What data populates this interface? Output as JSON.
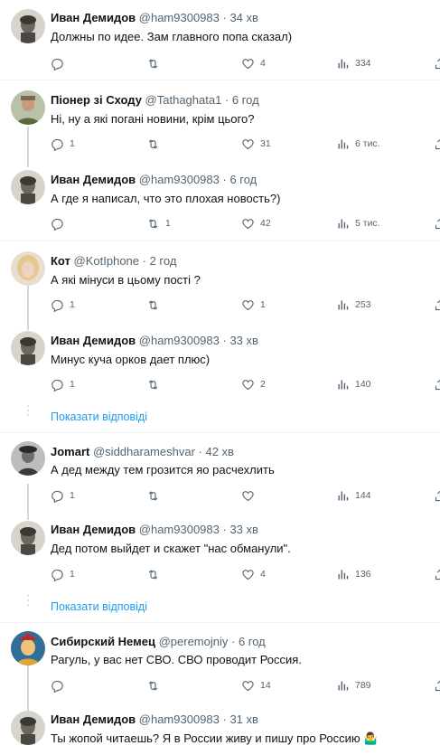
{
  "tweets": [
    {
      "name": "Иван Демидов",
      "handle": "@ham9300983",
      "time": "34 хв",
      "text": "Должны по идее. Зам главного попа сказал)",
      "reply": "",
      "retweet": "",
      "like": "4",
      "views": "334",
      "avatar": "statue"
    },
    {
      "name": "Піонер зі Сходу",
      "handle": "@Tathaghata1",
      "time": "6 год",
      "text": "Ні, ну а які погані новини, крім цього?",
      "reply": "1",
      "retweet": "",
      "like": "31",
      "views": "6 тис.",
      "avatar": "man"
    },
    {
      "name": "Иван Демидов",
      "handle": "@ham9300983",
      "time": "6 год",
      "text": "А где я написал, что это плохая новость?)",
      "reply": "",
      "retweet": "1",
      "like": "42",
      "views": "5 тис.",
      "avatar": "statue"
    },
    {
      "name": "Кот",
      "handle": "@KotIphone",
      "time": "2 год",
      "text": "А які мінуси в цьому пості ?",
      "reply": "1",
      "retweet": "",
      "like": "1",
      "views": "253",
      "avatar": "woman"
    },
    {
      "name": "Иван Демидов",
      "handle": "@ham9300983",
      "time": "33 хв",
      "text": "Минус куча орков дает плюс)",
      "reply": "1",
      "retweet": "",
      "like": "2",
      "views": "140",
      "avatar": "statue"
    },
    {
      "name": "Jomart",
      "handle": "@siddharameshvar",
      "time": "42 хв",
      "text": "А дед между тем грозится яо расчехлить",
      "reply": "1",
      "retweet": "",
      "like": "",
      "views": "144",
      "avatar": "bw"
    },
    {
      "name": "Иван Демидов",
      "handle": "@ham9300983",
      "time": "33 хв",
      "text": "Дед потом выйдет и скажет \"нас обманули\".",
      "reply": "1",
      "retweet": "",
      "like": "4",
      "views": "136",
      "avatar": "statue"
    },
    {
      "name": "Сибирский Немец",
      "handle": "@peremojniy",
      "time": "6 год",
      "text": "Рагуль, у вас нет СВО. СВО проводит Россия.",
      "reply": "",
      "retweet": "",
      "like": "14",
      "views": "789",
      "avatar": "colorful"
    },
    {
      "name": "Иван Демидов",
      "handle": "@ham9300983",
      "time": "31 хв",
      "text": "Ты жопой читаешь? Я в России живу и пишу про Россию 🤷‍♂️",
      "reply": "",
      "retweet": "",
      "like": "",
      "views": "",
      "avatar": "statue"
    }
  ],
  "show_replies_1": "Показати відповіді",
  "show_replies_2": "Показати відповіді",
  "separator": " · ",
  "icons": {
    "reply": "reply-icon",
    "retweet": "retweet-icon",
    "like": "like-icon",
    "views": "views-icon",
    "share": "share-icon"
  }
}
